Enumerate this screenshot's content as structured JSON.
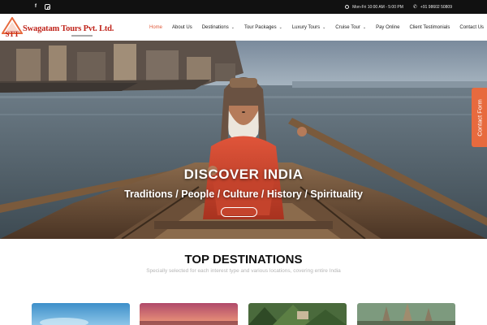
{
  "topbar": {
    "social": [
      {
        "icon": "facebook-icon",
        "glyph": "f"
      },
      {
        "icon": "instagram-icon",
        "glyph": ""
      }
    ],
    "hours": "Mon-Fri 10:00 AM - 5:00 PM",
    "phone": "+91 98602 50809"
  },
  "brand": {
    "logo_initials": "STT",
    "name": "Swagatam Tours Pvt. Ltd.",
    "colors": {
      "primary": "#c0251c",
      "accent": "#e76a3e",
      "dark": "#111111"
    }
  },
  "nav": {
    "items": [
      {
        "label": "Home",
        "active": true,
        "dropdown": false
      },
      {
        "label": "About Us",
        "active": false,
        "dropdown": false
      },
      {
        "label": "Destinations",
        "active": false,
        "dropdown": true
      },
      {
        "label": "Tour Packages",
        "active": false,
        "dropdown": true
      },
      {
        "label": "Luxury Tours",
        "active": false,
        "dropdown": true
      },
      {
        "label": "Cruise Tour",
        "active": false,
        "dropdown": true
      },
      {
        "label": "Pay Online",
        "active": false,
        "dropdown": false
      },
      {
        "label": "Client Testimonials",
        "active": false,
        "dropdown": false
      },
      {
        "label": "Contact Us",
        "active": false,
        "dropdown": false
      }
    ]
  },
  "hero": {
    "title": "DISCOVER INDIA",
    "subtitle": "Traditions / People / Culture / History / Spirituality",
    "button_label": ""
  },
  "contact_tab": {
    "label": "Contact Form"
  },
  "destinations": {
    "title": "TOP DESTINATIONS",
    "subtitle": "Specially selected for each interest type and various locations, covering entire India",
    "cards": [
      {
        "theme": "beach-sky"
      },
      {
        "theme": "sunset"
      },
      {
        "theme": "forest"
      },
      {
        "theme": "temple"
      }
    ]
  }
}
